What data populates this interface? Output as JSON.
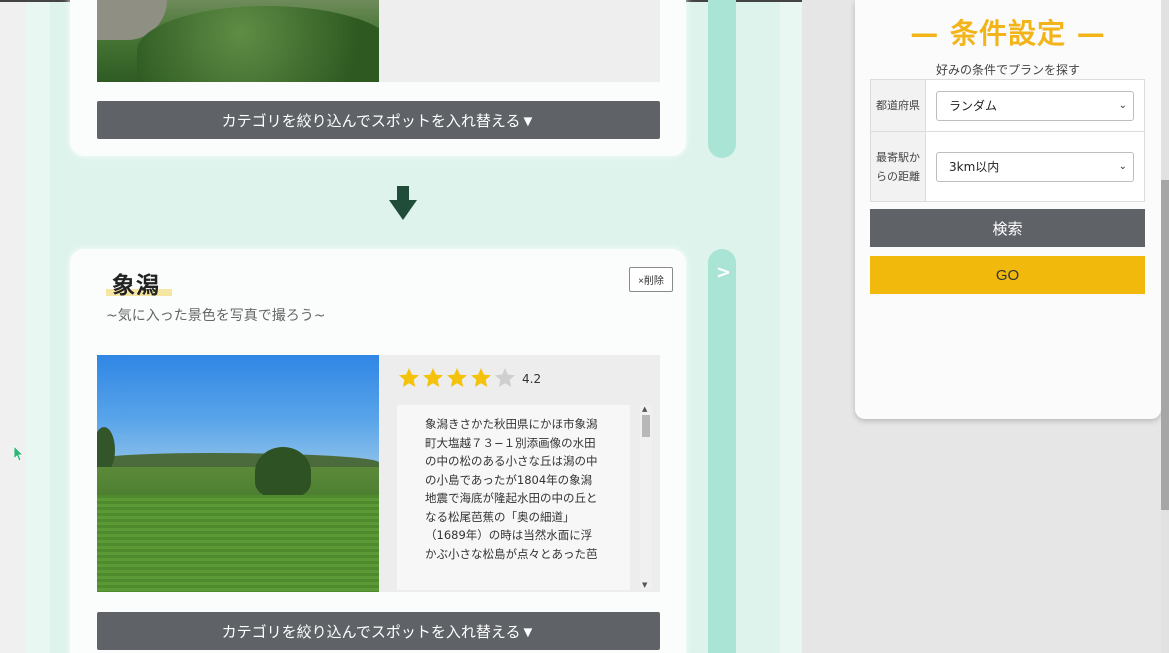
{
  "top_card": {
    "category_button_label": "カテゴリを絞り込んでスポットを入れ替える▼"
  },
  "spot": {
    "title": "象潟",
    "subtitle": "~気に入った景色を写真で撮ろう~",
    "delete_label": "×削除",
    "rating_value": "4.2",
    "rating_stars_filled": 4,
    "rating_stars_total": 5,
    "description": "象潟きさかた秋田県にかほ市象潟町大塩越７３−１別添画像の水田の中の松のある小さな丘は潟の中の小島であったが1804年の象潟地震で海底が隆起水田の中の丘となる松尾芭蕉の「奥の細道」（1689年）の時は当然水面に浮かぶ小さな松島が点々とあった芭",
    "category_button_label": "カテゴリを絞り込んでスポットを入れ替える▼",
    "next_arrow": ">"
  },
  "panel": {
    "title": "— 条件設定 —",
    "subtitle": "好みの条件でプランを探す",
    "rows": [
      {
        "label": "都道府県",
        "value": "ランダム"
      },
      {
        "label": "最寄駅からの距離",
        "value": "3km以内"
      }
    ],
    "search_label": "検索",
    "go_label": "GO"
  },
  "colors": {
    "accent_yellow": "#f2b418",
    "button_gray": "#5f6367",
    "mint": "#a9e4d4",
    "star": "#f4c20d",
    "arrow_green": "#1f4d3a"
  },
  "icons": {
    "down_arrow": "arrow-down-icon",
    "star": "star-icon",
    "chevron": "chevron-down-icon",
    "cursor": "cursor-icon"
  }
}
